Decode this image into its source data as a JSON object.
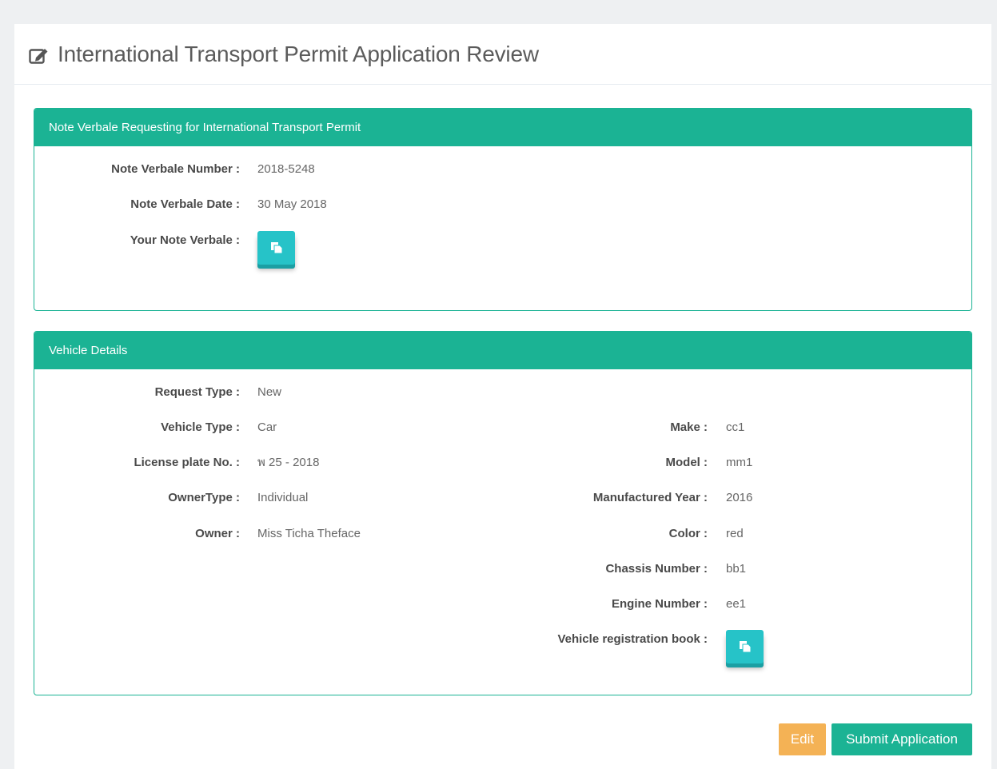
{
  "page": {
    "title": "International Transport Permit Application Review",
    "title_icon": "edit-icon"
  },
  "note_verbale": {
    "heading": "Note Verbale Requesting for International Transport Permit",
    "fields": {
      "number_label": "Note Verbale Number :",
      "number_value": "2018-5248",
      "date_label": "Note Verbale Date :",
      "date_value": "30 May 2018",
      "doc_label": "Your Note Verbale :",
      "doc_icon": "document-icon"
    }
  },
  "vehicle": {
    "heading": "Vehicle Details",
    "left": {
      "request_type_label": "Request Type :",
      "request_type_value": "New",
      "vehicle_type_label": "Vehicle Type :",
      "vehicle_type_value": "Car",
      "license_label": "License plate No. :",
      "license_value": "พ 25 - 2018",
      "owner_type_label": "OwnerType :",
      "owner_type_value": "Individual",
      "owner_label": "Owner :",
      "owner_value": "Miss Ticha Theface"
    },
    "right": {
      "make_label": "Make :",
      "make_value": "cc1",
      "model_label": "Model :",
      "model_value": "mm1",
      "year_label": "Manufactured Year :",
      "year_value": "2016",
      "color_label": "Color :",
      "color_value": "red",
      "chassis_label": "Chassis Number :",
      "chassis_value": "bb1",
      "engine_label": "Engine Number :",
      "engine_value": "ee1",
      "regbook_label": "Vehicle registration book :",
      "regbook_icon": "document-icon"
    }
  },
  "actions": {
    "edit_label": "Edit",
    "submit_label": "Submit Application"
  },
  "colors": {
    "accent": "#1bb394",
    "doc_button": "#26c3c8",
    "edit_button": "#f4b255"
  }
}
